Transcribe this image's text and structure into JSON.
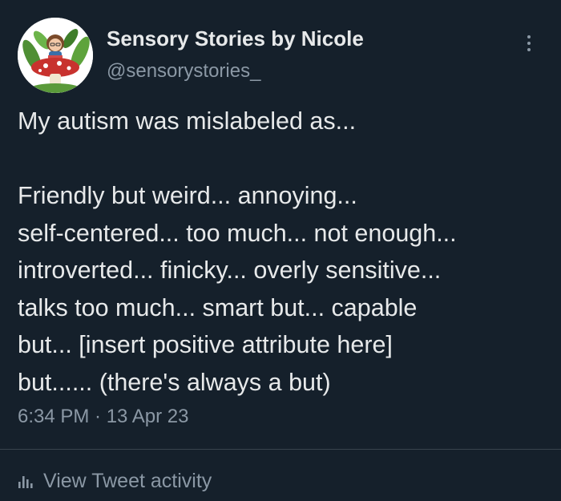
{
  "profile": {
    "display_name": "Sensory Stories by Nicole",
    "handle": "@sensorystories_",
    "avatar_icon": "avatar-illustration"
  },
  "tweet": {
    "lines": [
      "My autism was mislabeled as...",
      "",
      "Friendly but weird... annoying...",
      "self-centered... too much... not enough...",
      "introverted... finicky... overly sensitive...",
      "talks too much... smart but... capable",
      "but... [insert positive attribute here]",
      "but...... (there's always a but)"
    ],
    "timestamp": "6:34 PM · 13 Apr 23"
  },
  "actions": {
    "more_icon": "more-vertical-icon",
    "activity_icon": "bar-chart-icon",
    "activity_label": "View Tweet activity"
  },
  "colors": {
    "background": "#15202b",
    "primary_text": "#e7e9ea",
    "secondary_text": "#8b98a5",
    "divider": "#38444d"
  }
}
